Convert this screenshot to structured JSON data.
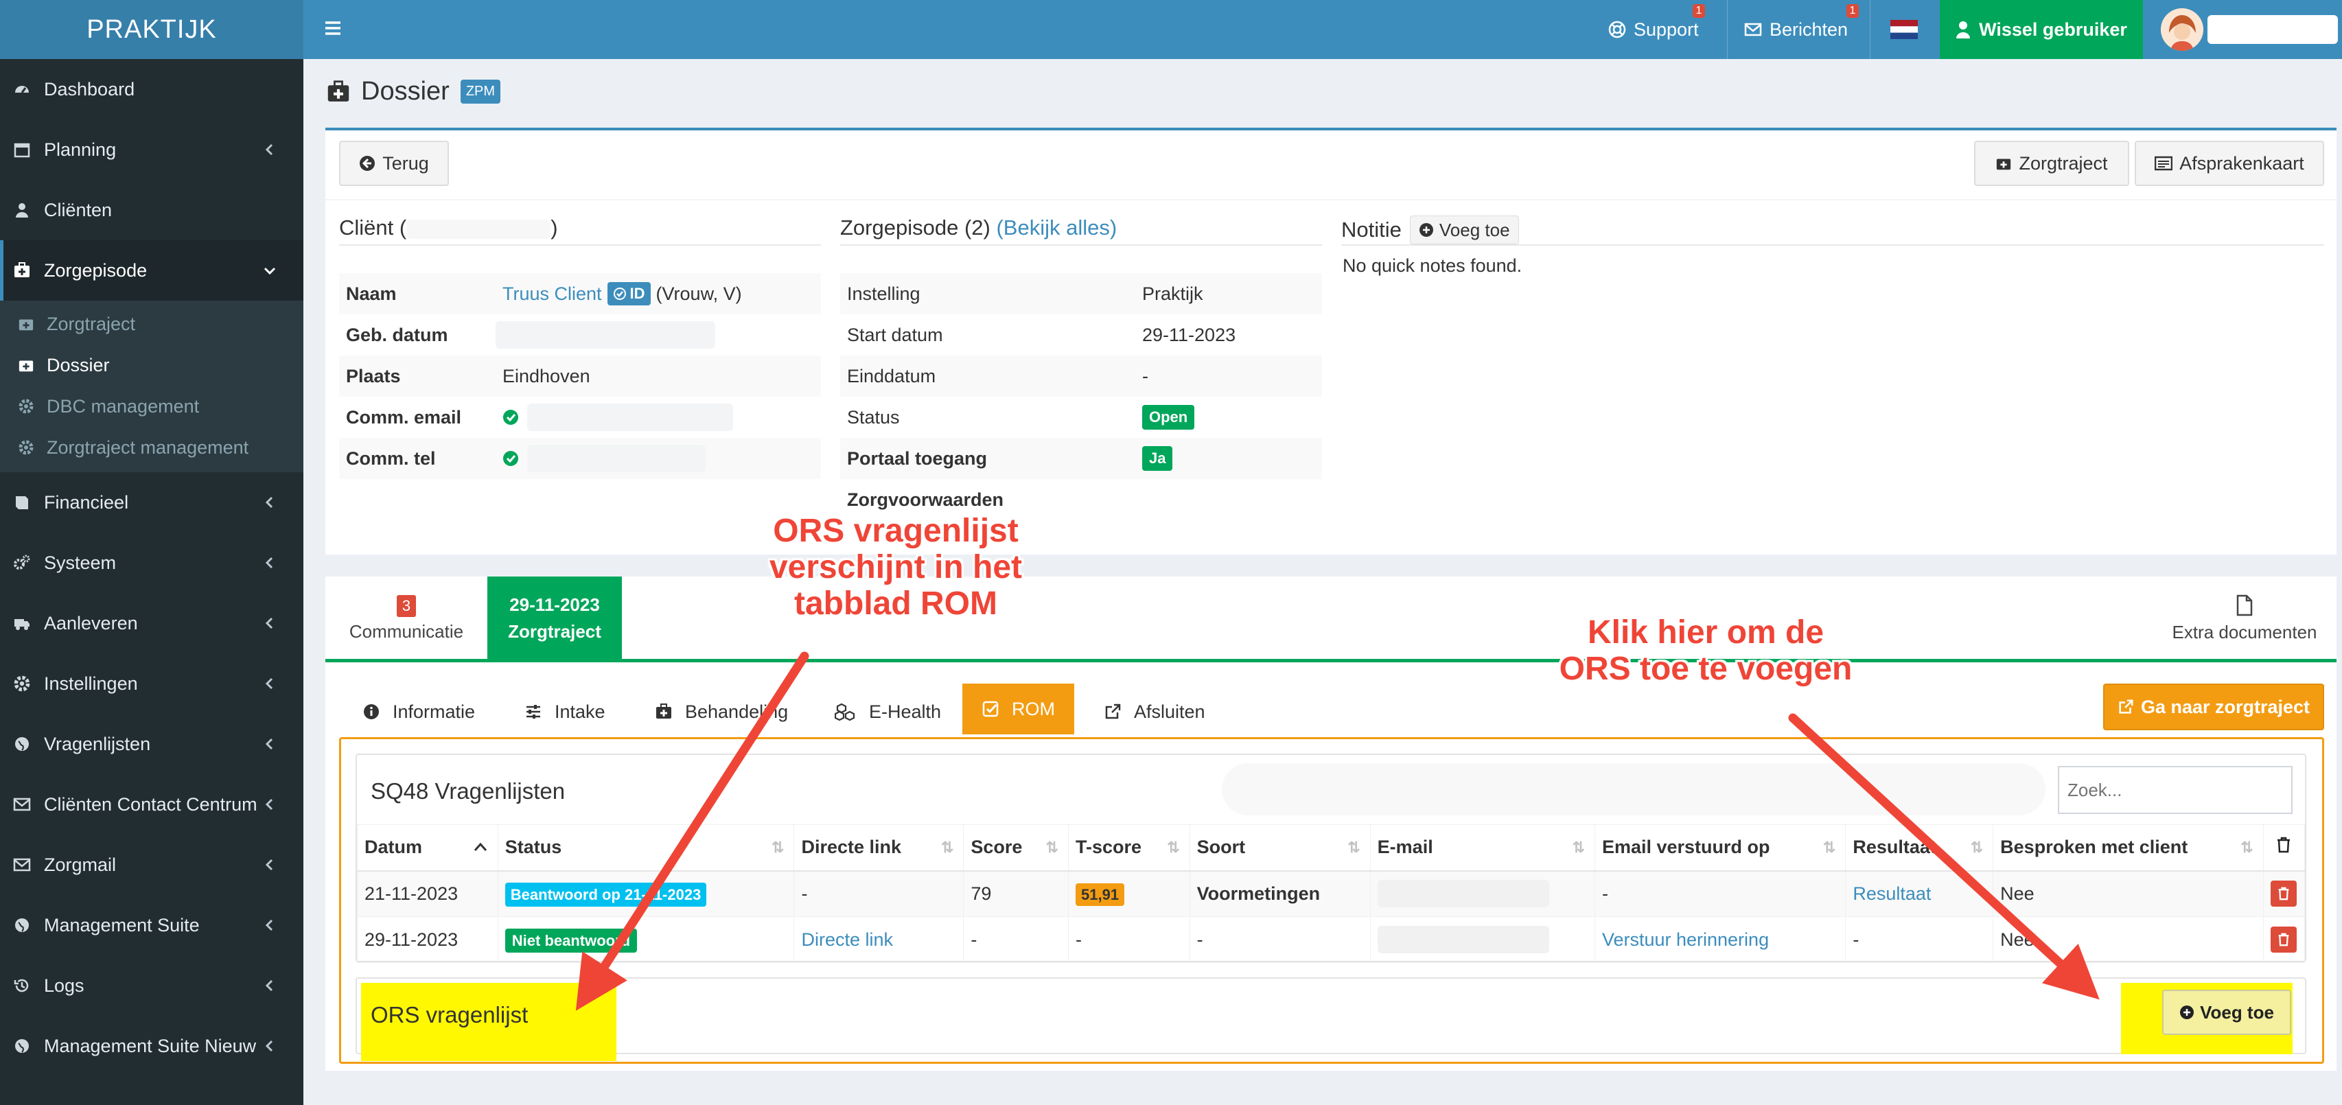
{
  "sidebar": {
    "brand": "PRAKTIJK",
    "items": [
      {
        "label": "Dashboard",
        "icon": "dashboard-icon"
      },
      {
        "label": "Planning",
        "icon": "calendar-icon"
      },
      {
        "label": "Cliënten",
        "icon": "user-icon"
      },
      {
        "label": "Zorgepisode",
        "icon": "medkit-icon"
      },
      {
        "label": "Financieel",
        "icon": "book-icon"
      },
      {
        "label": "Systeem",
        "icon": "cogs-icon"
      },
      {
        "label": "Aanleveren",
        "icon": "truck-icon"
      },
      {
        "label": "Instellingen",
        "icon": "gear-icon"
      },
      {
        "label": "Vragenlijsten",
        "icon": "globe-icon"
      },
      {
        "label": "Cliënten Contact Centrum",
        "icon": "envelope-icon"
      },
      {
        "label": "Zorgmail",
        "icon": "envelope-icon"
      },
      {
        "label": "Management Suite",
        "icon": "globe-icon"
      },
      {
        "label": "Logs",
        "icon": "history-icon"
      },
      {
        "label": "Management Suite Nieuw",
        "icon": "globe-icon"
      }
    ],
    "submenu": [
      {
        "label": "Zorgtraject",
        "icon": "medkit-icon"
      },
      {
        "label": "Dossier",
        "icon": "medkit-icon"
      },
      {
        "label": "DBC management",
        "icon": "gear-icon"
      },
      {
        "label": "Zorgtraject management",
        "icon": "gear-icon"
      }
    ]
  },
  "topbar": {
    "support": "Support",
    "support_count": "1",
    "berichten": "Berichten",
    "berichten_count": "1",
    "wissel": "Wissel gebruiker"
  },
  "page": {
    "title": "Dossier",
    "badge": "ZPM"
  },
  "toolbar": {
    "back": "Terug",
    "zorgtraject": "Zorgtraject",
    "afsprakenkaart": "Afsprakenkaart"
  },
  "client": {
    "heading_prefix": "Cliënt (",
    "heading_suffix": ")",
    "rows": [
      {
        "label": "Naam",
        "value": "Truus Client",
        "extra": "(Vrouw, V)",
        "id_badge": "ID"
      },
      {
        "label": "Geb. datum",
        "value": ""
      },
      {
        "label": "Plaats",
        "value": "Eindhoven"
      },
      {
        "label": "Comm. email",
        "value": ""
      },
      {
        "label": "Comm. tel",
        "value": ""
      }
    ]
  },
  "episode": {
    "heading": "Zorgepisode (2)",
    "link": "(Bekijk alles)",
    "rows": [
      {
        "label": "Instelling",
        "value": "Praktijk"
      },
      {
        "label": "Start datum",
        "value": "29-11-2023"
      },
      {
        "label": "Einddatum",
        "value": "-"
      },
      {
        "label": "Status",
        "value": "Open"
      },
      {
        "label": "Portaal toegang",
        "value": "Ja"
      },
      {
        "label": "Zorgvoorwaarden",
        "value": ""
      }
    ]
  },
  "notes": {
    "heading": "Notitie",
    "add": "Voeg toe",
    "empty": "No quick notes found."
  },
  "top_tabs": {
    "communicatie_count": "3",
    "communicatie": "Communicatie",
    "date": "29-11-2023",
    "zorgtraject": "Zorgtraject",
    "extra": "Extra documenten"
  },
  "sub_tabs": [
    {
      "label": "Informatie"
    },
    {
      "label": "Intake"
    },
    {
      "label": "Behandeling"
    },
    {
      "label": "E-Health"
    },
    {
      "label": "ROM"
    },
    {
      "label": "Afsluiten"
    }
  ],
  "goto_button": "Ga naar zorgtraject",
  "sq48": {
    "title": "SQ48 Vragenlijsten",
    "search_placeholder": "Zoek...",
    "columns": [
      "Datum",
      "Status",
      "Directe link",
      "Score",
      "T-score",
      "Soort",
      "E-mail",
      "Email verstuurd op",
      "Resultaat",
      "Besproken met client"
    ],
    "rows": [
      {
        "datum": "21-11-2023",
        "status": "Beantwoord op 21-11-2023",
        "link": "-",
        "score": "79",
        "tscore": "51,91",
        "soort": "Voormetingen",
        "email": "",
        "verstuurd": "-",
        "resultaat": "Resultaat",
        "besproken": "Nee"
      },
      {
        "datum": "29-11-2023",
        "status": "Niet beantwoord",
        "link": "Directe link",
        "score": "-",
        "tscore": "-",
        "soort": "-",
        "email": "",
        "verstuurd": "Verstuur herinnering",
        "resultaat": "-",
        "besproken": "Nee"
      }
    ]
  },
  "ors": {
    "title": "ORS vragenlijst",
    "add": "Voeg toe"
  },
  "annotations": {
    "left": "ORS vragenlijst verschijnt in het tabblad ROM",
    "left_lines": [
      "ORS vragenlijst",
      "verschijnt in het",
      "tabblad ROM"
    ],
    "right_lines": [
      "Klik hier om de",
      "ORS toe te voegen"
    ]
  },
  "colors": {
    "sidebar": "#222d32",
    "topbar": "#3c8dbc",
    "accent_green": "#00a65a",
    "accent_orange": "#f39c12",
    "annotation_red": "#ef4537",
    "highlight": "#fff800"
  }
}
